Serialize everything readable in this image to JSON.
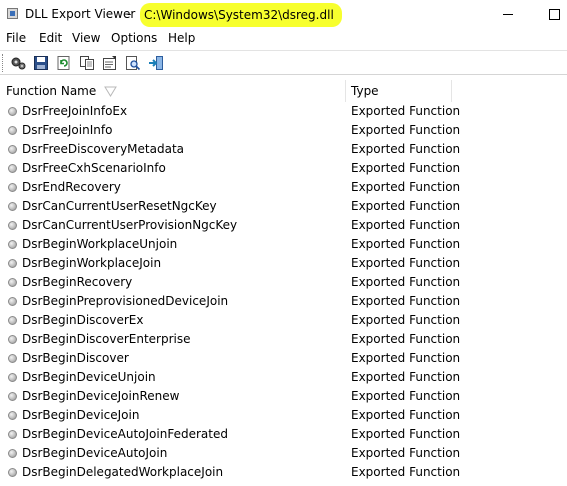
{
  "window": {
    "app_title": "DLL Export Viewer",
    "separator": "-",
    "file_path": "C:\\Windows\\System32\\dsreg.dll",
    "highlight_color": "#f7ff2e"
  },
  "menu": {
    "items": [
      {
        "label": "File"
      },
      {
        "label": "Edit"
      },
      {
        "label": "View"
      },
      {
        "label": "Options"
      },
      {
        "label": "Help"
      }
    ]
  },
  "toolbar": {
    "buttons": [
      {
        "icon": "select-functions-icon"
      },
      {
        "icon": "save-icon"
      },
      {
        "icon": "refresh-icon"
      },
      {
        "icon": "copy-icon"
      },
      {
        "icon": "properties-icon"
      },
      {
        "icon": "find-icon"
      },
      {
        "icon": "exit-icon"
      }
    ]
  },
  "list": {
    "columns": [
      {
        "label": "Function Name"
      },
      {
        "label": "Type"
      }
    ],
    "rows": [
      {
        "name": "DsrFreeJoinInfoEx",
        "type": "Exported Function"
      },
      {
        "name": "DsrFreeJoinInfo",
        "type": "Exported Function"
      },
      {
        "name": "DsrFreeDiscoveryMetadata",
        "type": "Exported Function"
      },
      {
        "name": "DsrFreeCxhScenarioInfo",
        "type": "Exported Function"
      },
      {
        "name": "DsrEndRecovery",
        "type": "Exported Function"
      },
      {
        "name": "DsrCanCurrentUserResetNgcKey",
        "type": "Exported Function"
      },
      {
        "name": "DsrCanCurrentUserProvisionNgcKey",
        "type": "Exported Function"
      },
      {
        "name": "DsrBeginWorkplaceUnjoin",
        "type": "Exported Function"
      },
      {
        "name": "DsrBeginWorkplaceJoin",
        "type": "Exported Function"
      },
      {
        "name": "DsrBeginRecovery",
        "type": "Exported Function"
      },
      {
        "name": "DsrBeginPreprovisionedDeviceJoin",
        "type": "Exported Function"
      },
      {
        "name": "DsrBeginDiscoverEx",
        "type": "Exported Function"
      },
      {
        "name": "DsrBeginDiscoverEnterprise",
        "type": "Exported Function"
      },
      {
        "name": "DsrBeginDiscover",
        "type": "Exported Function"
      },
      {
        "name": "DsrBeginDeviceUnjoin",
        "type": "Exported Function"
      },
      {
        "name": "DsrBeginDeviceJoinRenew",
        "type": "Exported Function"
      },
      {
        "name": "DsrBeginDeviceJoin",
        "type": "Exported Function"
      },
      {
        "name": "DsrBeginDeviceAutoJoinFederated",
        "type": "Exported Function"
      },
      {
        "name": "DsrBeginDeviceAutoJoin",
        "type": "Exported Function"
      },
      {
        "name": "DsrBeginDelegatedWorkplaceJoin",
        "type": "Exported Function"
      }
    ]
  }
}
